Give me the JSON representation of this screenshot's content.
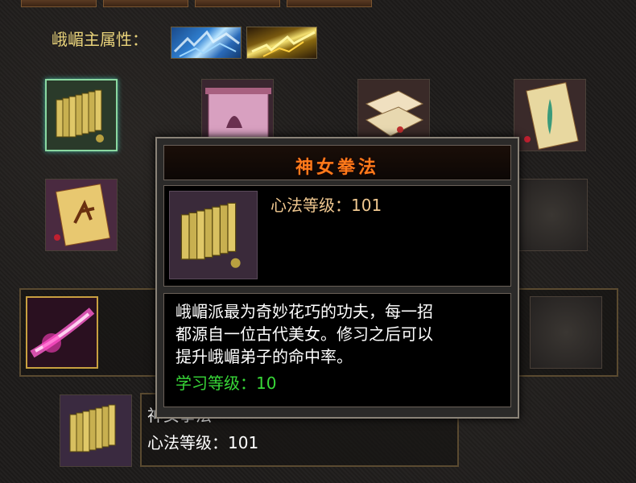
{
  "attributes": {
    "label": "峨嵋主属性：",
    "elements": [
      "ice",
      "thunder"
    ]
  },
  "skill_slots": [
    {
      "name": "bamboo-scroll",
      "selected": true
    },
    {
      "name": "purple-scroll"
    },
    {
      "name": "book-stack"
    },
    {
      "name": "lady-painting"
    },
    {
      "name": "dancer-scroll"
    },
    {
      "name": "empty"
    }
  ],
  "active_skill": {
    "name": "pink-slash"
  },
  "tooltip": {
    "title": "神女拳法",
    "level_label": "心法等级：101",
    "description": [
      "峨嵋派最为奇妙花巧的功夫，每一招",
      "都源自一位古代美女。修习之后可以",
      "提升峨嵋弟子的命中率。"
    ],
    "requirement": "学习等级：10"
  },
  "bottom_panel": {
    "name_partial": "神女拳法",
    "level_label": "心法等级：101"
  },
  "colors": {
    "title": "#ff7a1a",
    "requirement": "#38d838",
    "attr_label": "#e8d27a"
  }
}
